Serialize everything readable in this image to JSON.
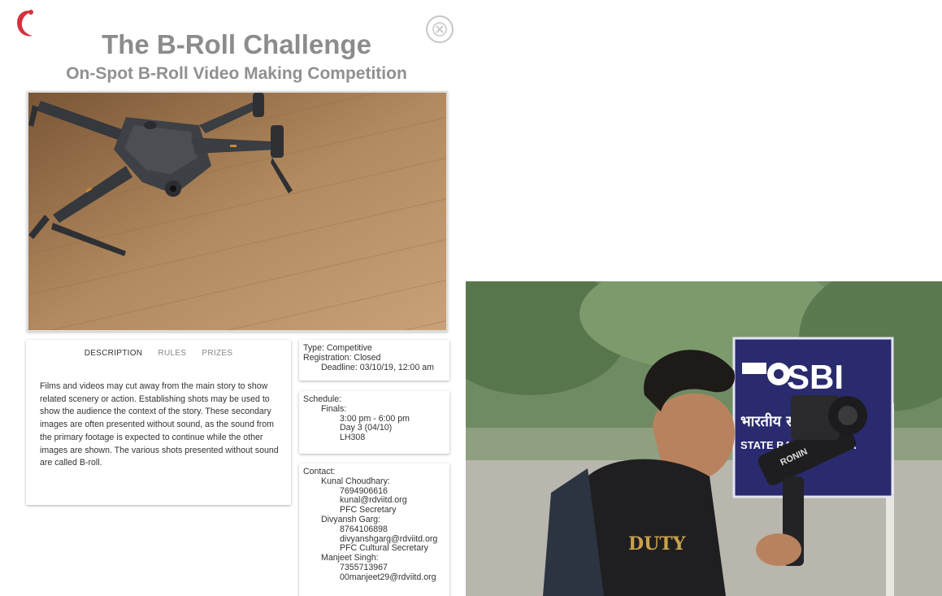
{
  "brand": {
    "logo_icon": "red-crescent-logo-icon",
    "accent_color": "#d6313d"
  },
  "header": {
    "title": "The B-Roll Challenge",
    "subtitle": "On-Spot B-Roll Video Making Competition",
    "close_icon": "close-circle-icon"
  },
  "hero_image": {
    "alt": "drone-on-wooden-floor"
  },
  "tabs": [
    {
      "label": "DESCRIPTION",
      "active": true
    },
    {
      "label": "RULES",
      "active": false
    },
    {
      "label": "PRIZES",
      "active": false
    }
  ],
  "description": "Films and videos may cut away from the main story to show related scenery or action. Establishing shots may be used to show the audience the context of the story. These secondary images are often presented without sound, as the sound from the primary footage is expected to continue while the other images are shown. The various shots presented without sound are called B-roll.",
  "event_info": {
    "type": "Type: Competitive",
    "registration": "Registration: Closed",
    "deadline": "Deadline: 03/10/19, 12:00 am"
  },
  "schedule": {
    "heading": "Schedule:",
    "round": "Finals:",
    "time": "3:00 pm - 6:00 pm",
    "day": "Day 3 (04/10)",
    "venue": "LH308"
  },
  "contact": {
    "heading": "Contact:",
    "people": [
      {
        "name": "Kunal Choudhary:",
        "phone": "7694906616",
        "email": "kunal@rdviitd.org",
        "role": "PFC Secretary"
      },
      {
        "name": "Divyansh Garg:",
        "phone": "8764106898",
        "email": "divyanshgarg@rdviitd.org",
        "role": "PFC Cultural Secretary"
      },
      {
        "name": "Manjeet Singh:",
        "phone": "7355713967",
        "email": "00manjeet29@rdviitd.org"
      }
    ]
  },
  "side_photo": {
    "sign_text": "SBI",
    "sign_hindi": "भारतीय स्टेट बैंक",
    "sign_english": "STATE BANK OF INDIA",
    "gimbal_label": "RONIN",
    "shirt_text": "DUTY"
  }
}
